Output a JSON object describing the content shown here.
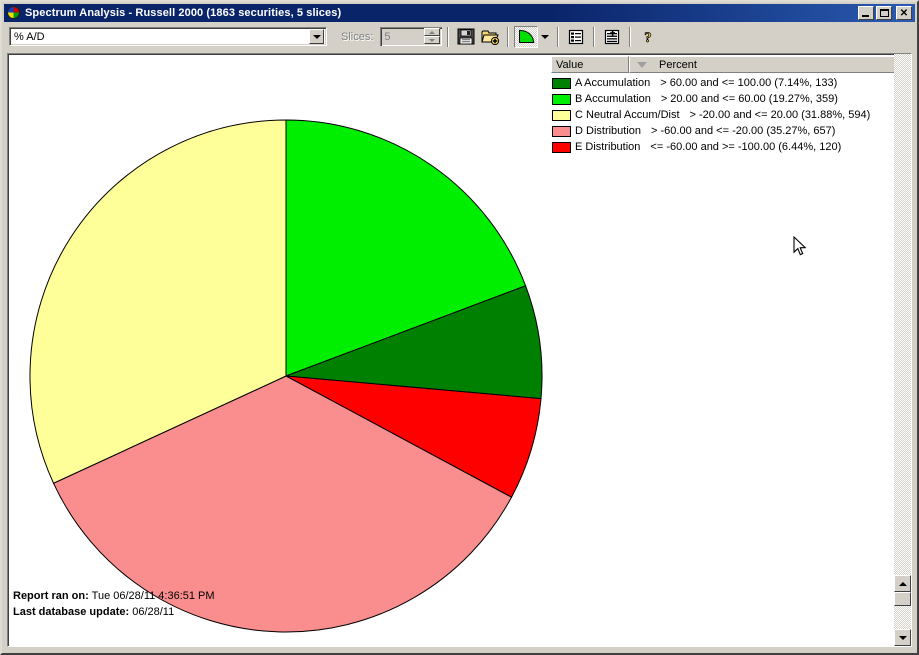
{
  "window": {
    "title": "Spectrum Analysis - Russell 2000 (1863 securities, 5 slices)",
    "icon": "pie-chart-icon",
    "minimize_label": "Minimize",
    "maximize_label": "Maximize",
    "close_label": "✕"
  },
  "toolbar": {
    "field_select_value": "% A/D",
    "field_select_placeholder": "% A/D",
    "slices_label": "Slices:",
    "slices_value": "5",
    "buttons": [
      {
        "name": "save-button",
        "icon": "floppy-disk-icon",
        "label": "Save"
      },
      {
        "name": "open-button",
        "icon": "open-folder-plus-icon",
        "label": "Open"
      },
      {
        "name": "pie-chart-view-button",
        "icon": "pie-chart-icon",
        "label": "Pie Chart View"
      },
      {
        "name": "chart-type-dropdown",
        "icon": "chevron-down-icon",
        "label": "Chart Type"
      },
      {
        "name": "list-view-button",
        "icon": "list-report-icon",
        "label": "List View"
      },
      {
        "name": "detail-report-button",
        "icon": "report-plus-icon",
        "label": "Detail Report"
      },
      {
        "name": "help-button",
        "icon": "question-mark-icon",
        "label": "Help"
      }
    ]
  },
  "legend": {
    "columns": [
      {
        "label": "Value"
      },
      {
        "label": "Percent",
        "sort": "descending"
      }
    ]
  },
  "footer": {
    "report_ran_label": "Report ran on:",
    "report_ran_value": "Tue 06/28/11 4:36:51 PM",
    "last_update_label": "Last database update:",
    "last_update_value": "06/28/11"
  },
  "chart_data": {
    "type": "pie",
    "title": "Spectrum Analysis - Russell 2000",
    "subtitle": "% A/D",
    "total_securities": 1863,
    "slice_count": 5,
    "start_angle_deg": 0,
    "direction": "clockwise",
    "legend_position": "right",
    "categories": [
      "A Accumulation",
      "B Accumulation",
      "C Neutral Accum/Dist",
      "D Distribution",
      "E Distribution"
    ],
    "values": [
      7.14,
      19.27,
      31.88,
      35.27,
      6.44
    ],
    "counts": [
      133,
      359,
      594,
      657,
      120
    ],
    "ranges": [
      "> 60.00 and <= 100.00",
      "> 20.00 and <= 60.00",
      "> -20.00 and <= 20.00",
      "> -60.00 and <= -20.00",
      "<= -60.00 and >= -100.00"
    ],
    "colors": [
      "#008000",
      "#00ee00",
      "#ffff99",
      "#fa8d8d",
      "#ff0000"
    ],
    "slices": [
      {
        "key": "A",
        "label": "A Accumulation",
        "range": "> 60.00 and <= 100.00",
        "percent": 7.14,
        "count": 133,
        "percent_text": "(7.14%, 133)",
        "color": "#008000",
        "draw_order": 2
      },
      {
        "key": "B",
        "label": "B Accumulation",
        "range": "> 20.00 and <= 60.00",
        "percent": 19.27,
        "count": 359,
        "percent_text": "(19.27%, 359)",
        "color": "#00ee00",
        "draw_order": 1
      },
      {
        "key": "C",
        "label": "C Neutral Accum/Dist",
        "range": "> -20.00 and <= 20.00",
        "percent": 31.88,
        "count": 594,
        "percent_text": "(31.88%, 594)",
        "color": "#ffff99",
        "draw_order": 5
      },
      {
        "key": "D",
        "label": "D Distribution",
        "range": "> -60.00 and <= -20.00",
        "percent": 35.27,
        "count": 657,
        "percent_text": "(35.27%, 657)",
        "color": "#fa8d8d",
        "draw_order": 4
      },
      {
        "key": "E",
        "label": "E Distribution",
        "range": "<= -60.00 and >= -100.00",
        "percent": 6.44,
        "count": 120,
        "percent_text": "(6.44%, 120)",
        "color": "#ff0000",
        "draw_order": 3
      }
    ]
  }
}
